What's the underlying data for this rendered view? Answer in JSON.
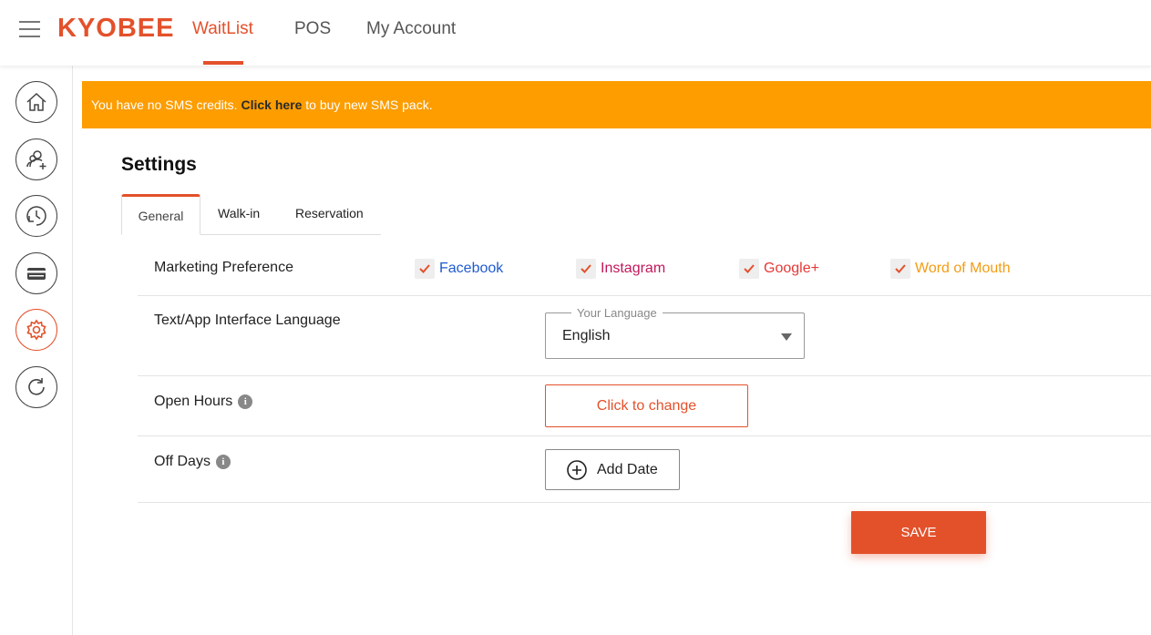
{
  "app": {
    "logo": "KYOBEE"
  },
  "nav": [
    {
      "label": "WaitList",
      "active": true
    },
    {
      "label": "POS",
      "active": false
    },
    {
      "label": "My Account",
      "active": false
    }
  ],
  "sidebar": {
    "items": [
      {
        "icon": "home-icon"
      },
      {
        "icon": "add-user-icon"
      },
      {
        "icon": "history-icon"
      },
      {
        "icon": "card-icon"
      },
      {
        "icon": "gear-icon",
        "active": true
      },
      {
        "icon": "refresh-icon"
      }
    ]
  },
  "banner": {
    "prefix": "You have no SMS credits.",
    "link": "Click here",
    "suffix": "to buy new SMS pack."
  },
  "settings": {
    "title": "Settings",
    "tabs": [
      "General",
      "Walk-in",
      "Reservation"
    ],
    "marketing": {
      "label": "Marketing Preference",
      "options": [
        {
          "label": "Facebook",
          "checked": true,
          "color": "#1e5bd1"
        },
        {
          "label": "Instagram",
          "checked": true,
          "color": "#c2185b"
        },
        {
          "label": "Google+",
          "checked": true,
          "color": "#e53935"
        },
        {
          "label": "Word of Mouth",
          "checked": true,
          "color": "#f39c12"
        }
      ]
    },
    "language": {
      "label": "Text/App Interface Language",
      "legend": "Your Language",
      "value": "English"
    },
    "open_hours": {
      "label": "Open Hours",
      "button": "Click to change"
    },
    "off_days": {
      "label": "Off Days",
      "button": "Add Date"
    },
    "save": "SAVE"
  },
  "colors": {
    "accent": "#e3512b",
    "banner": "#fd9d00"
  }
}
